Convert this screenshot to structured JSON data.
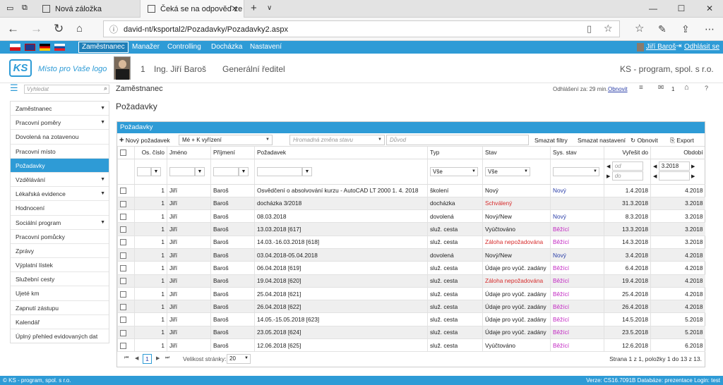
{
  "browser": {
    "tab1_title": "Nová záložka",
    "tab2_title": "Čeká se na odpověď ze",
    "url": "david-nt/ksportal2/Pozadavky/Pozadavky2.aspx"
  },
  "topnav": {
    "items": [
      "Zaměstnanec",
      "Manažer",
      "Controlling",
      "Docházka",
      "Nastavení"
    ],
    "user": "Jiří Baroš",
    "logout": "Odhlásit se"
  },
  "header": {
    "slogan": "Místo pro Vaše logo",
    "number": "1",
    "name": "Ing. Jiří Baroš",
    "position": "Generální ředitel",
    "company": "KS - program, spol. s r.o."
  },
  "sub": {
    "search_placeholder": "Vyhledat",
    "section": "Zaměstnanec",
    "logout_info": "Odhlášení za: 29 min.",
    "renew": "Obnovit",
    "mail_count": "1"
  },
  "sidebar": {
    "items": [
      "Zaměstnanec",
      "Pracovní poměry",
      "Dovolená na zotavenou",
      "Pracovní místo",
      "Požadavky",
      "Vzdělávání",
      "Lékařská evidence",
      "Hodnocení",
      "Sociální program",
      "Pracovní pomůcky",
      "Zprávy",
      "Výplatní lístek",
      "Služební cesty",
      "Ujeté km",
      "Zapnutí zástupu",
      "Kalendář",
      "Úplný přehled evidovaných dat"
    ]
  },
  "page_title": "Požadavky",
  "panel": {
    "title": "Požadavky",
    "new": "Nový požadavek",
    "filter_mine": "Mé + K vyřízení",
    "mass_change": "Hromadná změna stavu",
    "reason": "Důvod",
    "clear_filters": "Smazat filtry",
    "clear_settings": "Smazat nastavení",
    "refresh": "Obnovit",
    "export": "Export"
  },
  "columns": {
    "os": "Os. číslo",
    "jmeno": "Jméno",
    "prijmeni": "Příjmení",
    "pozadavek": "Požadavek",
    "typ": "Typ",
    "stav": "Stav",
    "sys": "Sys. stav",
    "vyresit": "Vyřešit do",
    "obdobi": "Období"
  },
  "filters": {
    "typ": "Vše",
    "stav": "Vše",
    "od": "od",
    "do": "do",
    "obdobi": "3.2018"
  },
  "rows": [
    {
      "os": "1",
      "jmeno": "Jiří",
      "prijmeni": "Baroš",
      "pozadavek": "Osvědčení o absolvování kurzu - AutoCAD LT 2000 1. 4. 2018",
      "typ": "školení",
      "stav": "Nový",
      "sys": "Nový",
      "vyresit": "1.4.2018",
      "obdobi": "4.2018"
    },
    {
      "os": "1",
      "jmeno": "Jiří",
      "prijmeni": "Baroš",
      "pozadavek": "docházka 3/2018",
      "typ": "docházka",
      "stav": "Schválený",
      "sys": "",
      "vyresit": "31.3.2018",
      "obdobi": "3.2018"
    },
    {
      "os": "1",
      "jmeno": "Jiří",
      "prijmeni": "Baroš",
      "pozadavek": "08.03.2018",
      "typ": "dovolená",
      "stav": "Nový/New",
      "sys": "Nový",
      "vyresit": "8.3.2018",
      "obdobi": "3.2018"
    },
    {
      "os": "1",
      "jmeno": "Jiří",
      "prijmeni": "Baroš",
      "pozadavek": "13.03.2018 [617]",
      "typ": "služ. cesta",
      "stav": "Vyúčtováno",
      "sys": "Běžící",
      "vyresit": "13.3.2018",
      "obdobi": "3.2018"
    },
    {
      "os": "1",
      "jmeno": "Jiří",
      "prijmeni": "Baroš",
      "pozadavek": "14.03.-16.03.2018 [618]",
      "typ": "služ. cesta",
      "stav": "Záloha nepožadována",
      "sys": "Běžící",
      "vyresit": "14.3.2018",
      "obdobi": "3.2018"
    },
    {
      "os": "1",
      "jmeno": "Jiří",
      "prijmeni": "Baroš",
      "pozadavek": "03.04.2018-05.04.2018",
      "typ": "dovolená",
      "stav": "Nový/New",
      "sys": "Nový",
      "vyresit": "3.4.2018",
      "obdobi": "4.2018"
    },
    {
      "os": "1",
      "jmeno": "Jiří",
      "prijmeni": "Baroš",
      "pozadavek": "06.04.2018 [619]",
      "typ": "služ. cesta",
      "stav": "Údaje pro vyúč. zadány",
      "sys": "Běžící",
      "vyresit": "6.4.2018",
      "obdobi": "4.2018"
    },
    {
      "os": "1",
      "jmeno": "Jiří",
      "prijmeni": "Baroš",
      "pozadavek": "19.04.2018 [620]",
      "typ": "služ. cesta",
      "stav": "Záloha nepožadována",
      "sys": "Běžící",
      "vyresit": "19.4.2018",
      "obdobi": "4.2018"
    },
    {
      "os": "1",
      "jmeno": "Jiří",
      "prijmeni": "Baroš",
      "pozadavek": "25.04.2018 [621]",
      "typ": "služ. cesta",
      "stav": "Údaje pro vyúč. zadány",
      "sys": "Běžící",
      "vyresit": "25.4.2018",
      "obdobi": "4.2018"
    },
    {
      "os": "1",
      "jmeno": "Jiří",
      "prijmeni": "Baroš",
      "pozadavek": "26.04.2018 [622]",
      "typ": "služ. cesta",
      "stav": "Údaje pro vyúč. zadány",
      "sys": "Běžící",
      "vyresit": "26.4.2018",
      "obdobi": "4.2018"
    },
    {
      "os": "1",
      "jmeno": "Jiří",
      "prijmeni": "Baroš",
      "pozadavek": "14.05.-15.05.2018 [623]",
      "typ": "služ. cesta",
      "stav": "Údaje pro vyúč. zadány",
      "sys": "Běžící",
      "vyresit": "14.5.2018",
      "obdobi": "5.2018"
    },
    {
      "os": "1",
      "jmeno": "Jiří",
      "prijmeni": "Baroš",
      "pozadavek": "23.05.2018 [624]",
      "typ": "služ. cesta",
      "stav": "Údaje pro vyúč. zadány",
      "sys": "Běžící",
      "vyresit": "23.5.2018",
      "obdobi": "5.2018"
    },
    {
      "os": "1",
      "jmeno": "Jiří",
      "prijmeni": "Baroš",
      "pozadavek": "12.06.2018 [625]",
      "typ": "služ. cesta",
      "stav": "Vyúčtováno",
      "sys": "Běžící",
      "vyresit": "12.6.2018",
      "obdobi": "6.2018"
    }
  ],
  "pager": {
    "current": "1",
    "size_label": "Velikost stránky:",
    "size": "20",
    "summary": "Strana 1 z 1, položky 1 do 13 z 13."
  },
  "footer": {
    "left": "© KS - program, spol. s r.o.",
    "right": "Verze: CS16.7091B   Databáze: prezentace   Login: test"
  },
  "colors": {
    "accent": "#2e9bd6",
    "red": "#d62a2a",
    "blue": "#2a3ea8",
    "magenta": "#c226c2"
  }
}
